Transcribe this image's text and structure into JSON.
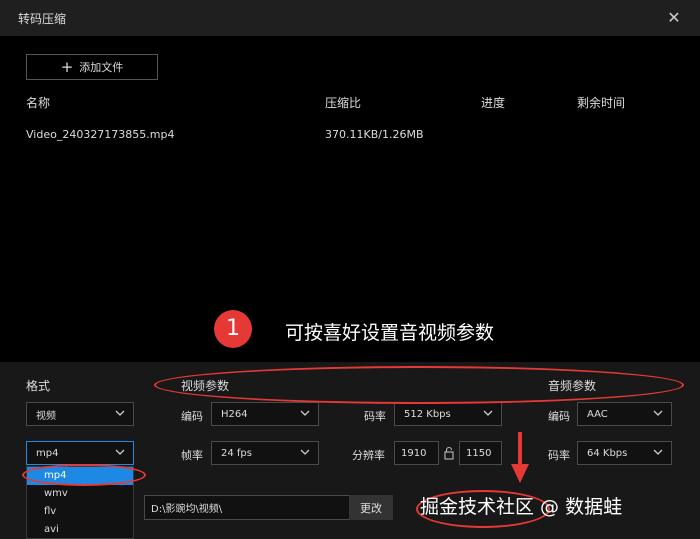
{
  "window": {
    "title": "转码压缩"
  },
  "toolbar": {
    "add_file_label": "添加文件"
  },
  "table": {
    "headers": [
      "名称",
      "压缩比",
      "进度",
      "剩余时间"
    ],
    "rows": [
      {
        "name": "Video_240327173855.mp4",
        "ratio": "370.11KB/1.26MB",
        "progress": "",
        "remaining": ""
      }
    ]
  },
  "annotation": {
    "number": "1",
    "text": "可按喜好设置音视频参数"
  },
  "format": {
    "title": "格式",
    "type_value": "视频",
    "container_value": "mp4",
    "options": [
      "mp4",
      "wmv",
      "flv",
      "avi"
    ],
    "selected_index": 0
  },
  "video": {
    "title": "视频参数",
    "codec_label": "编码",
    "codec_value": "H264",
    "bitrate_label": "码率",
    "bitrate_value": "512 Kbps",
    "framerate_label": "帧率",
    "framerate_value": "24 fps",
    "resolution_label": "分辨率",
    "width_value": "1910",
    "height_value": "1150"
  },
  "audio": {
    "title": "音频参数",
    "codec_label": "编码",
    "codec_value": "AAC",
    "bitrate_label": "码率",
    "bitrate_value": "64 Kbps"
  },
  "output": {
    "path": "D:\\影豌均\\视频\\",
    "change_label": "更改"
  },
  "watermark": "掘金技术社区 @ 数据蛙",
  "colors": {
    "accent": "#1e88e5",
    "annotation": "#e53935",
    "background": "#000000",
    "panel": "#181818"
  },
  "icons": {
    "add": "plus-icon",
    "close": "close-icon",
    "dropdown": "chevron-down-icon",
    "lock": "lock-icon"
  }
}
